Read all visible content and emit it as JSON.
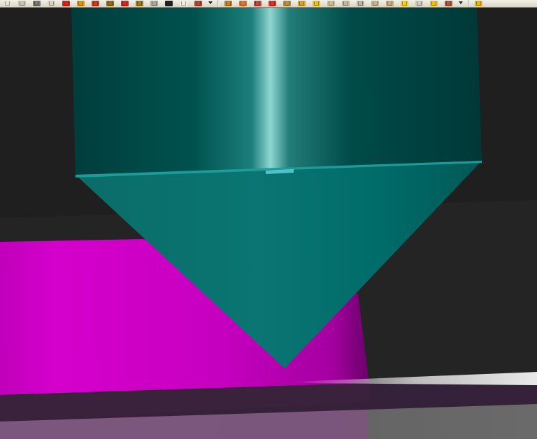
{
  "app": {
    "colors": {
      "background": "#1f1f1f",
      "toolbar": "#e4e1d4",
      "tool_body": "#005f5f",
      "tool_highlight": "#8fd6d2",
      "workpiece": "#d000c8",
      "floor": "#76577a"
    }
  },
  "toolbar": {
    "left_group": [
      {
        "name": "new-icon",
        "color": "#e7e3d7"
      },
      {
        "name": "open-icon",
        "color": "#c8c4b8"
      },
      {
        "name": "line-icon",
        "color": "#777777"
      },
      {
        "name": "save-icon",
        "color": "#d9d4c7"
      },
      {
        "name": "delete-icon",
        "color": "#cc2a1f"
      },
      {
        "name": "tool-path-icon",
        "color": "#d39a18"
      },
      {
        "name": "toolpath-edit-icon",
        "color": "#c23f2a"
      },
      {
        "name": "select-icon",
        "color": "#8d6d1d"
      },
      {
        "name": "trim-icon",
        "color": "#c33223"
      },
      {
        "name": "extend-icon",
        "color": "#9b7b2b"
      },
      {
        "name": "grid-icon",
        "color": "#aaa7a0"
      },
      {
        "name": "measure-icon",
        "color": "#222222"
      },
      {
        "name": "rectangle-icon",
        "color": "#f1eee4"
      },
      {
        "name": "target-icon",
        "color": "#b04a36"
      }
    ],
    "right_group": [
      {
        "name": "pan-icon",
        "color": "#b9862f"
      },
      {
        "name": "rotate-icon",
        "color": "#d57a31"
      },
      {
        "name": "zoom-box-icon",
        "color": "#b84c3f"
      },
      {
        "name": "dynamic-view-icon",
        "color": "#d13b2d"
      },
      {
        "name": "fit-view-icon",
        "color": "#b48e42"
      },
      {
        "name": "orbit-icon",
        "color": "#d1a436"
      },
      {
        "name": "shade-icon",
        "color": "#e7c228"
      },
      {
        "name": "wireframe-icon",
        "color": "#c9bc9a"
      },
      {
        "name": "top-view-icon",
        "color": "#c3b9a4"
      },
      {
        "name": "front-view-icon",
        "color": "#bcb5a8"
      },
      {
        "name": "side-view-icon",
        "color": "#c4b392"
      },
      {
        "name": "iso-view-icon",
        "color": "#bfae7e"
      },
      {
        "name": "light-icon",
        "color": "#f0ce25"
      },
      {
        "name": "sphere-icon",
        "color": "#cdc7c2"
      },
      {
        "name": "folder-icon",
        "color": "#e7bd2c"
      },
      {
        "name": "options-icon",
        "color": "#aa5b44"
      }
    ],
    "extra_icon": {
      "name": "star-icon",
      "color": "#e2b51a"
    }
  }
}
